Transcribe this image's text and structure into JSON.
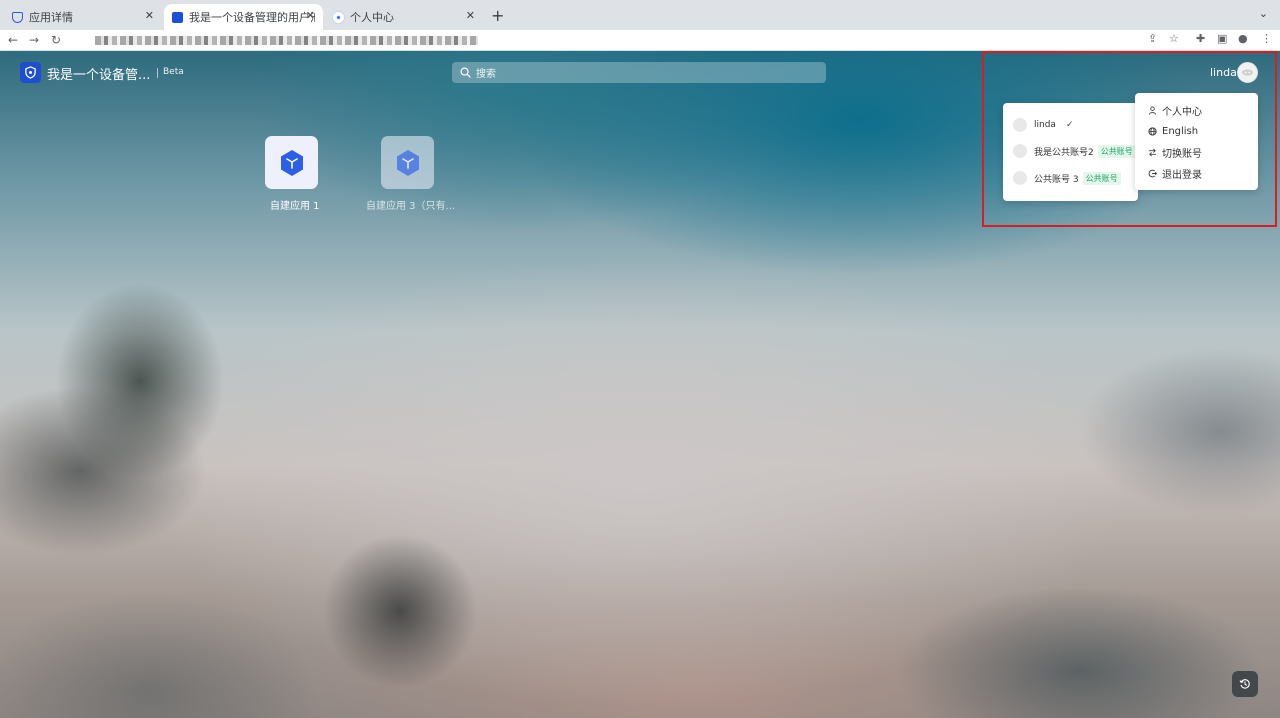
{
  "browser": {
    "tabs": [
      {
        "label": "应用详情",
        "active": false
      },
      {
        "label": "我是一个设备管理的用户池",
        "active": true
      },
      {
        "label": "个人中心",
        "active": false
      }
    ],
    "new_tab": "+",
    "close": "✕",
    "tab_menu": "⌄"
  },
  "header": {
    "app_title": "我是一个设备管...",
    "beta": "Beta",
    "search_placeholder": "搜索",
    "username": "linda"
  },
  "apps": [
    {
      "label": "自建应用 1",
      "dimmed": false
    },
    {
      "label": "自建应用 3（只有...",
      "dimmed": true
    }
  ],
  "account_switcher": {
    "accounts": [
      {
        "name": "linda",
        "current": true,
        "check": "✓"
      },
      {
        "name": "我是公共账号2",
        "tag": "公共账号"
      },
      {
        "name": "公共账号 3",
        "tag": "公共账号"
      }
    ]
  },
  "user_menu": {
    "items": [
      {
        "label": "个人中心",
        "icon": "user-icon"
      },
      {
        "label": "English",
        "icon": "globe-icon"
      },
      {
        "label": "切换账号",
        "icon": "switch-icon"
      },
      {
        "label": "退出登录",
        "icon": "logout-icon"
      }
    ]
  },
  "colors": {
    "brand": "#1f4fd1",
    "tag_text": "#1aa260",
    "tag_bg": "#e3f7ec",
    "highlight": "#d81e1e"
  }
}
